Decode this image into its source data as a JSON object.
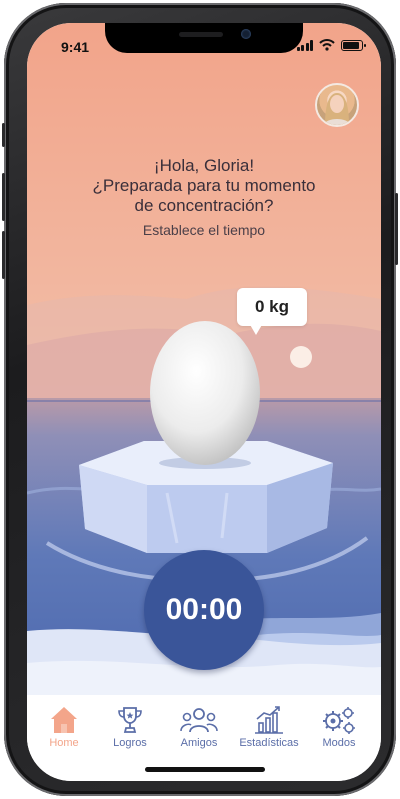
{
  "status_bar": {
    "time": "9:41"
  },
  "greeting": {
    "line1": "¡Hola, Gloria!",
    "line2": "¿Preparada para tu momento",
    "line3": "de concentración?"
  },
  "subtitle": "Establece el tiempo",
  "weight_bubble": "0 kg",
  "timer": "00:00",
  "colors": {
    "sky_top": "#f2a98f",
    "sky_bottom": "#f3d3c3",
    "sea": "#4f6fb3",
    "timer": "#3a5599",
    "nav_active": "#f3a58a",
    "nav_inactive": "#5b6ea8"
  },
  "nav": {
    "items": [
      {
        "label": "Home",
        "icon": "home-icon",
        "active": true
      },
      {
        "label": "Logros",
        "icon": "trophy-icon",
        "active": false
      },
      {
        "label": "Amigos",
        "icon": "friends-icon",
        "active": false
      },
      {
        "label": "Estadísticas",
        "icon": "chart-icon",
        "active": false
      },
      {
        "label": "Modos",
        "icon": "gears-icon",
        "active": false
      }
    ]
  }
}
